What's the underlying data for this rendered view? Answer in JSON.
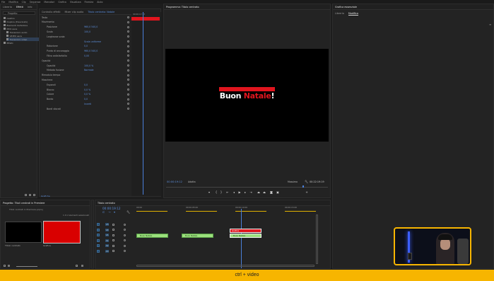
{
  "menubar": {
    "items": [
      "File",
      "Modifica",
      "Clip",
      "Sequenza",
      "Marcatori",
      "Grafica",
      "Visualizza",
      "Finestra",
      "Aiuto"
    ]
  },
  "project_panel": {
    "tabs": [
      "Libreria",
      "Effetti",
      "Info"
    ],
    "search": "Progetto",
    "items": [
      "Cestino",
      "Duplica (Trascinato)",
      "Elementi Cartellone",
      "MOV esca",
      "Transizioni audio",
      "VIDEO esca",
      "Transizioni video",
      "Effetti"
    ],
    "footer_label": ""
  },
  "effect_controls": {
    "tabs": [
      "Controllo effetti",
      "Mixer clip audio",
      "Titolo centrato: Natale"
    ],
    "rows": [
      {
        "label": "Testo",
        "value": ""
      },
      {
        "label": "Movimento",
        "value": ""
      },
      {
        "label": "Posizione",
        "value": "960,0   540,0"
      },
      {
        "label": "Scala",
        "value": "100,0"
      },
      {
        "label": "Larghezza scala",
        "value": ""
      },
      {
        "label": "",
        "value": "Scala uniforme"
      },
      {
        "label": "Rotazione",
        "value": "0,0"
      },
      {
        "label": "Punto di ancoraggio",
        "value": "960,0   540,0"
      },
      {
        "label": "Filtro antisfarfallio",
        "value": "0,00"
      },
      {
        "label": "Opacità",
        "value": ""
      },
      {
        "label": "Opacità",
        "value": "100,0 %"
      },
      {
        "label": "Metodo fusione",
        "value": "Normale"
      },
      {
        "label": "Rimodula tempo",
        "value": ""
      },
      {
        "label": "Maschera",
        "value": ""
      },
      {
        "label": "Espandi",
        "value": "0,0"
      },
      {
        "label": "Blocco",
        "value": "0,0 %"
      },
      {
        "label": "Colore",
        "value": "0,0 %"
      },
      {
        "label": "Bordo",
        "value": "0,0"
      },
      {
        "label": "",
        "value": "Inverti"
      },
      {
        "label": "Bordi sfocati",
        "value": ""
      }
    ],
    "timecode": "00:00:17:13",
    "playhead_label": "Grafiche"
  },
  "program_monitor": {
    "tab": "Programma: Titolo centrato",
    "title_white": "Buon ",
    "title_red": "Natale",
    "title_end": "!",
    "timecode_left": "00:00:19:12",
    "fit": "Adatta",
    "quality": "Massima",
    "timecode_right": "00:22:19:19"
  },
  "right_panel": {
    "tabs": [
      "Libreria",
      "Modifica"
    ],
    "header": "Grafica essenziale"
  },
  "project_bin": {
    "tabs": [
      "Progetto: Titoli centrati in Premiere"
    ],
    "path": "Titoli centrati in Premiere.prproj",
    "count": "1 di 2 elementi selezionati",
    "items": [
      {
        "name": "Titolo centrato",
        "color": "#000000"
      },
      {
        "name": "Grafica",
        "color": "#d90000"
      }
    ]
  },
  "timeline": {
    "tab": "Titolo centrato",
    "timecode": "00:00:19:12",
    "ruler": [
      "00:00",
      "00:00:05:00",
      "00:00:10:00",
      "00:00:15:00"
    ],
    "tracks": [
      "V3",
      "V2",
      "V1",
      "A1",
      "A2",
      "A3"
    ],
    "clips": [
      {
        "label": "Buon Natale",
        "row": 2
      },
      {
        "label": "Buon Natale",
        "row": 2
      },
      {
        "label": "Buon Natale",
        "row": 2
      }
    ],
    "graphic_clip_label": "Grafica"
  },
  "caption": "ctrl + video",
  "colors": {
    "accent_blue": "#4a7fd9",
    "brand_red": "#e0151e",
    "caption_bar": "#f7b500",
    "clip_green": "#9be07c"
  }
}
